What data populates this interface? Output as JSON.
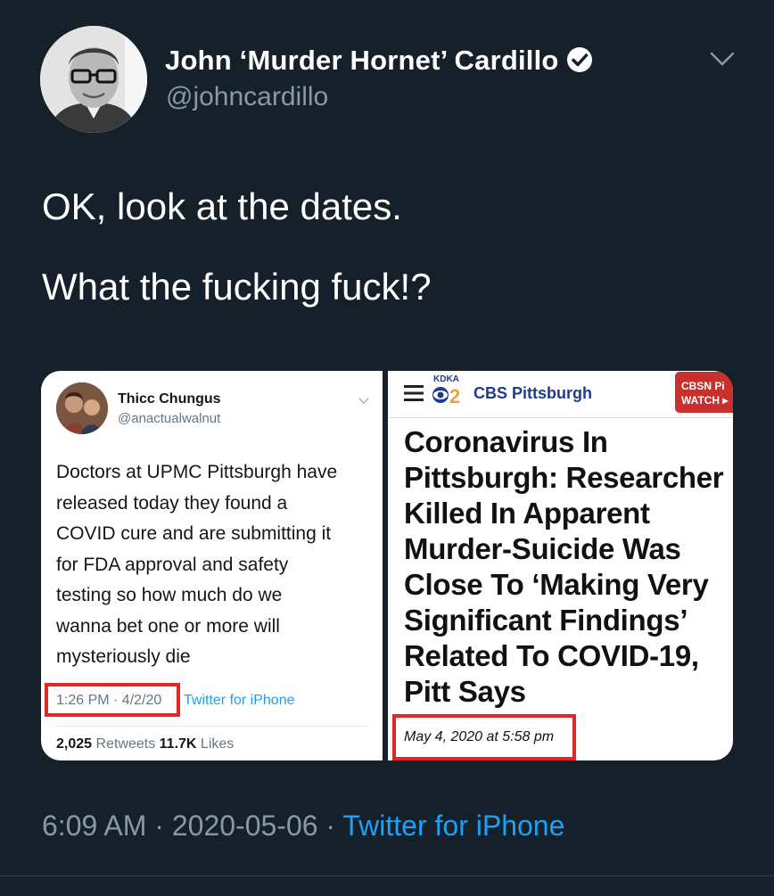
{
  "author": {
    "display_name": "John ‘Murder Hornet’ Cardillo",
    "handle": "@johncardillo"
  },
  "tweet": {
    "lines": [
      "OK, look at the dates.",
      "What the fucking fuck!?"
    ]
  },
  "embedded_tweet": {
    "display_name": "Thicc Chungus",
    "handle": "@anactualwalnut",
    "body_lines": [
      "Doctors at UPMC Pittsburgh have",
      "released today they found a",
      "COVID cure and are submitting it",
      "for FDA approval and safety",
      "testing so how much do we",
      "wanna bet one or more will",
      "mysteriously die"
    ],
    "timestamp": "1:26 PM · 4/2/20",
    "source": "Twitter for iPhone",
    "retweets_count": "2,025",
    "retweets_label": "Retweets",
    "likes_count": "11.7K",
    "likes_label": "Likes"
  },
  "article": {
    "station_logo": "KDKA",
    "station_number": "2",
    "brand": "CBS Pittsburgh",
    "cbsn_line1": "CBSN Pi",
    "cbsn_line2": "WATCH ▸",
    "headline_lines": [
      "Coronavirus In",
      "Pittsburgh: Researcher",
      "Killed In Apparent",
      "Murder-Suicide Was",
      "Close To ‘Making Very",
      "Significant Findings’",
      "Related To COVID-19,",
      "Pitt Says"
    ],
    "date": "May 4, 2020 at 5:58 pm"
  },
  "footer": {
    "time": "6:09 AM",
    "separator": " · ",
    "date": "2020-05-06",
    "source": "Twitter for iPhone"
  },
  "colors": {
    "background": "#15202b",
    "link": "#1da1f2",
    "muted": "#8899a6",
    "highlight": "#e32626"
  }
}
